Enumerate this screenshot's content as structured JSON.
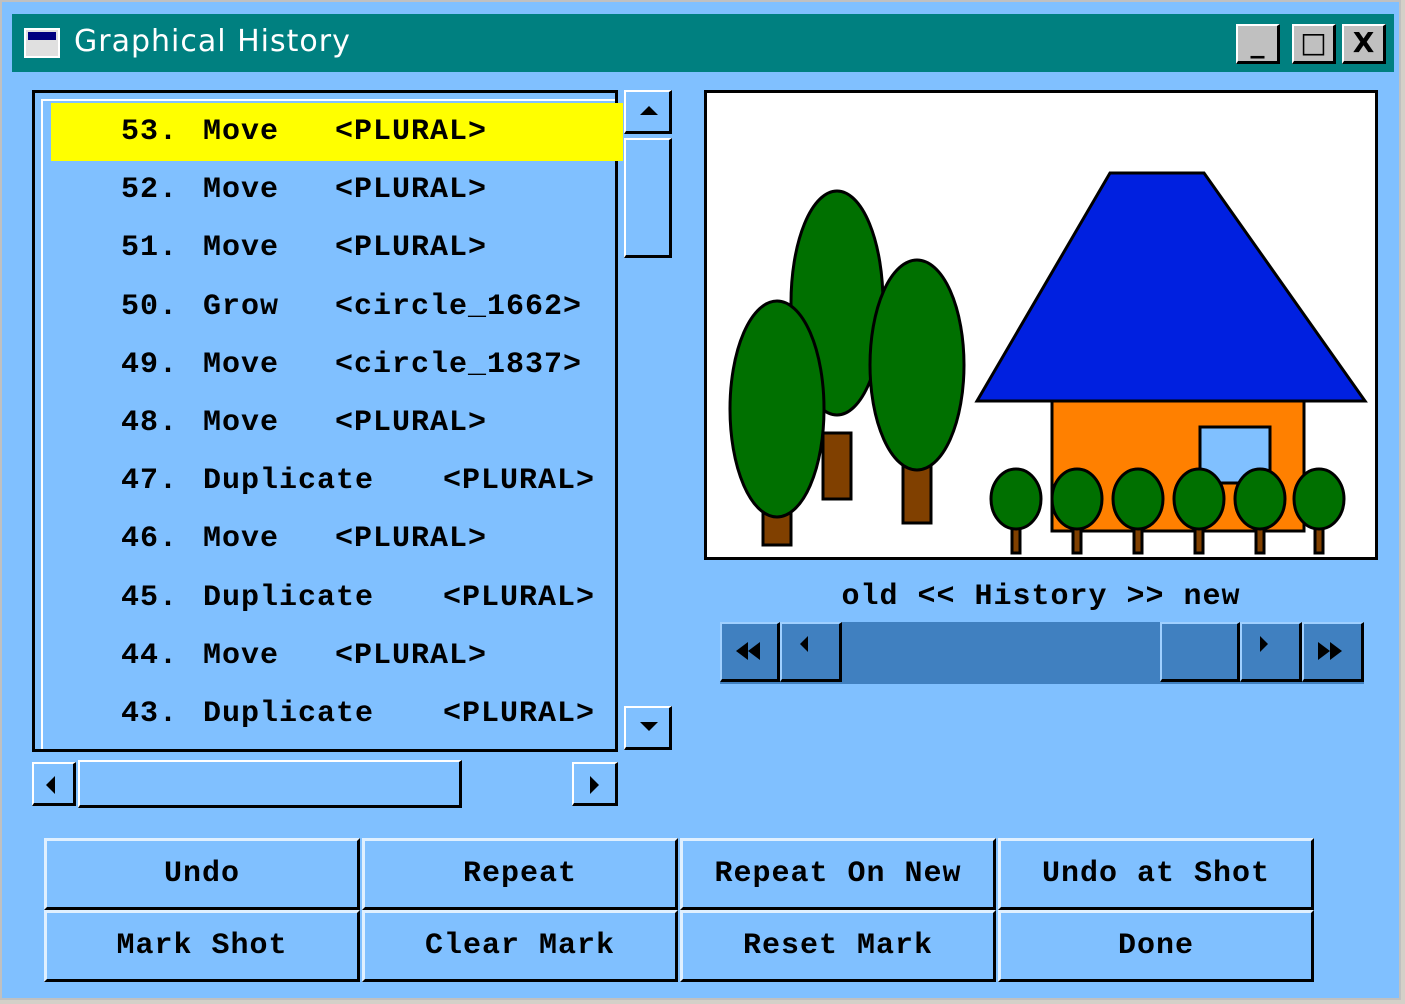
{
  "window": {
    "title": "Graphical History"
  },
  "titlebar_buttons": {
    "minimize": "_",
    "maximize": "□",
    "close": "X"
  },
  "history_list": {
    "items": [
      {
        "num": "53.",
        "cmd": "Move",
        "target": "<PLURAL>",
        "selected": true
      },
      {
        "num": "52.",
        "cmd": "Move",
        "target": "<PLURAL>"
      },
      {
        "num": "51.",
        "cmd": "Move",
        "target": "<PLURAL>"
      },
      {
        "num": "50.",
        "cmd": "Grow",
        "target": "<circle_1662>"
      },
      {
        "num": "49.",
        "cmd": "Move",
        "target": "<circle_1837>"
      },
      {
        "num": "48.",
        "cmd": "Move",
        "target": "<PLURAL>"
      },
      {
        "num": "47.",
        "cmd": "Duplicate",
        "target": "<PLURAL>"
      },
      {
        "num": "46.",
        "cmd": "Move",
        "target": "<PLURAL>"
      },
      {
        "num": "45.",
        "cmd": "Duplicate",
        "target": "<PLURAL>"
      },
      {
        "num": "44.",
        "cmd": "Move",
        "target": "<PLURAL>"
      },
      {
        "num": "43.",
        "cmd": "Duplicate",
        "target": "<PLURAL>"
      }
    ]
  },
  "history_slider": {
    "label": "old << History >> new"
  },
  "buttons": {
    "row1": [
      "Undo",
      "Repeat",
      "Repeat On New",
      "Undo at Shot"
    ],
    "row2": [
      "Mark Shot",
      "Clear Mark",
      "Reset Mark",
      "Done"
    ]
  },
  "colors": {
    "window_bg": "#80c0ff",
    "titlebar": "#008080",
    "selection": "#ffff00",
    "tree_foliage": "#007000",
    "tree_trunk": "#804000",
    "roof": "#0020e0",
    "house_wall": "#ff8000",
    "window_pane": "#80c0ff"
  }
}
